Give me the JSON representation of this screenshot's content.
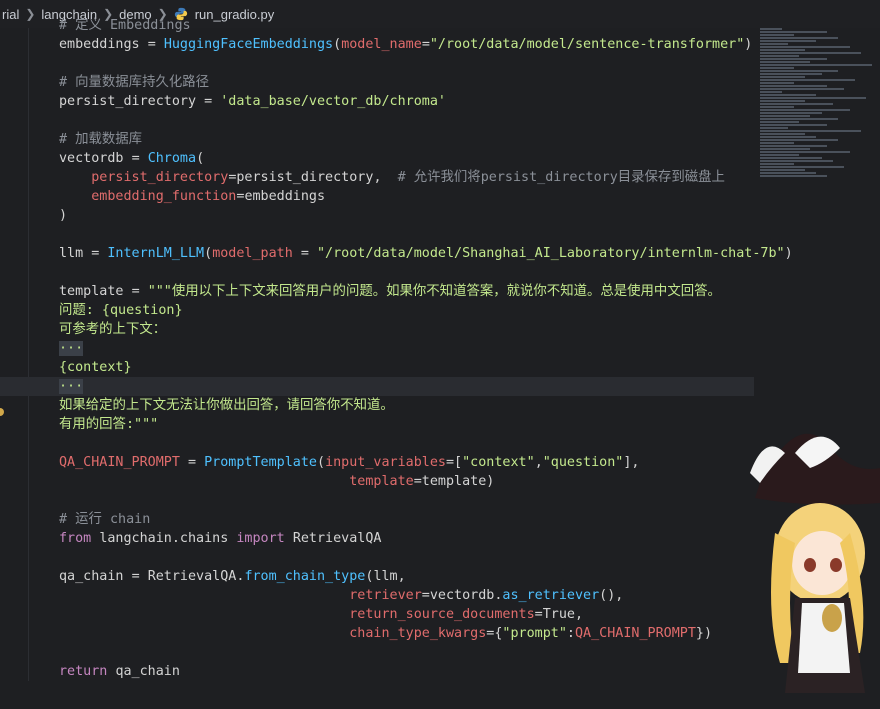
{
  "breadcrumb": {
    "items": [
      "rial",
      "langchain",
      "demo",
      "run_gradio.py"
    ]
  },
  "code_lines": [
    {
      "parts": [
        [
          "cmt",
          "# 定义 Embeddings"
        ]
      ]
    },
    {
      "parts": [
        [
          "var",
          "embeddings "
        ],
        [
          "op",
          "= "
        ],
        [
          "fn",
          "HuggingFaceEmbeddings"
        ],
        [
          "op",
          "("
        ],
        [
          "param",
          "model_name"
        ],
        [
          "op",
          "="
        ],
        [
          "strg",
          "\"/root/data/model/sentence-transformer\""
        ],
        [
          "op",
          ")"
        ]
      ]
    },
    {
      "parts": []
    },
    {
      "parts": [
        [
          "cmt",
          "# 向量数据库持久化路径"
        ]
      ]
    },
    {
      "parts": [
        [
          "var",
          "persist_directory "
        ],
        [
          "op",
          "= "
        ],
        [
          "strg",
          "'data_base/vector_db/chroma'"
        ]
      ]
    },
    {
      "parts": []
    },
    {
      "parts": [
        [
          "cmt",
          "# 加载数据库"
        ]
      ]
    },
    {
      "parts": [
        [
          "var",
          "vectordb "
        ],
        [
          "op",
          "= "
        ],
        [
          "fn",
          "Chroma"
        ],
        [
          "op",
          "("
        ]
      ]
    },
    {
      "parts": [
        [
          "param",
          "    persist_directory"
        ],
        [
          "op",
          "="
        ],
        [
          "var",
          "persist_directory"
        ],
        [
          "op",
          ",  "
        ],
        [
          "cmt",
          "# 允许我们将persist_directory目录保存到磁盘上"
        ]
      ]
    },
    {
      "parts": [
        [
          "param",
          "    embedding_function"
        ],
        [
          "op",
          "="
        ],
        [
          "var",
          "embeddings"
        ]
      ]
    },
    {
      "parts": [
        [
          "op",
          ")"
        ]
      ]
    },
    {
      "parts": []
    },
    {
      "parts": [
        [
          "var",
          "llm "
        ],
        [
          "op",
          "= "
        ],
        [
          "fn",
          "InternLM_LLM"
        ],
        [
          "op",
          "("
        ],
        [
          "param",
          "model_path "
        ],
        [
          "op",
          "= "
        ],
        [
          "strg",
          "\"/root/data/model/Shanghai_AI_Laboratory/internlm-chat-7b\""
        ],
        [
          "op",
          ")"
        ]
      ]
    },
    {
      "parts": []
    },
    {
      "parts": [
        [
          "var",
          "template "
        ],
        [
          "op",
          "= "
        ],
        [
          "strg",
          "\"\"\"使用以下上下文来回答用户的问题。如果你不知道答案，就说你不知道。总是使用中文回答。"
        ]
      ]
    },
    {
      "parts": [
        [
          "tmpl",
          "问题: {question}"
        ]
      ]
    },
    {
      "parts": [
        [
          "tmpl",
          "可参考的上下文："
        ]
      ]
    },
    {
      "parts": [
        [
          "sel",
          "···"
        ]
      ]
    },
    {
      "parts": [
        [
          "tmpl",
          "{context}"
        ]
      ]
    },
    {
      "parts": [
        [
          "sel",
          "···"
        ]
      ],
      "current": true
    },
    {
      "parts": [
        [
          "tmpl",
          "如果给定的上下文无法让你做出回答，请回答你不知道。"
        ]
      ]
    },
    {
      "parts": [
        [
          "tmpl",
          "有用的回答:\"\"\""
        ]
      ]
    },
    {
      "parts": []
    },
    {
      "parts": [
        [
          "param",
          "QA_CHAIN_PROMPT "
        ],
        [
          "op",
          "= "
        ],
        [
          "fn",
          "PromptTemplate"
        ],
        [
          "op",
          "("
        ],
        [
          "param",
          "input_variables"
        ],
        [
          "op",
          "=["
        ],
        [
          "strg",
          "\"context\""
        ],
        [
          "op",
          ","
        ],
        [
          "strg",
          "\"question\""
        ],
        [
          "op",
          "],"
        ]
      ]
    },
    {
      "parts": [
        [
          "op",
          "                                    "
        ],
        [
          "param",
          "template"
        ],
        [
          "op",
          "="
        ],
        [
          "var",
          "template"
        ],
        [
          "op",
          ")"
        ]
      ]
    },
    {
      "parts": []
    },
    {
      "parts": [
        [
          "cmt",
          "# 运行 chain"
        ]
      ]
    },
    {
      "parts": [
        [
          "kw",
          "from "
        ],
        [
          "var",
          "langchain.chains "
        ],
        [
          "kw",
          "import "
        ],
        [
          "var",
          "RetrievalQA"
        ]
      ]
    },
    {
      "parts": []
    },
    {
      "parts": [
        [
          "var",
          "qa_chain "
        ],
        [
          "op",
          "= "
        ],
        [
          "var",
          "RetrievalQA."
        ],
        [
          "fn",
          "from_chain_type"
        ],
        [
          "op",
          "("
        ],
        [
          "var",
          "llm"
        ],
        [
          "op",
          ","
        ]
      ]
    },
    {
      "parts": [
        [
          "op",
          "                                    "
        ],
        [
          "param",
          "retriever"
        ],
        [
          "op",
          "="
        ],
        [
          "var",
          "vectordb."
        ],
        [
          "fn",
          "as_retriever"
        ],
        [
          "op",
          "(),"
        ]
      ]
    },
    {
      "parts": [
        [
          "op",
          "                                    "
        ],
        [
          "param",
          "return_source_documents"
        ],
        [
          "op",
          "="
        ],
        [
          "var",
          "True"
        ],
        [
          "op",
          ","
        ]
      ]
    },
    {
      "parts": [
        [
          "op",
          "                                    "
        ],
        [
          "param",
          "chain_type_kwargs"
        ],
        [
          "op",
          "={"
        ],
        [
          "strg",
          "\"prompt\""
        ],
        [
          "op",
          ":"
        ],
        [
          "param",
          "QA_CHAIN_PROMPT"
        ],
        [
          "op",
          "})"
        ]
      ]
    },
    {
      "parts": []
    },
    {
      "parts": [
        [
          "kw",
          "return "
        ],
        [
          "var",
          "qa_chain"
        ]
      ]
    }
  ],
  "colors": {
    "background": "#1e1f22",
    "comment": "#8b9098",
    "function": "#4fc1ff",
    "string": "#c3e88d",
    "parameter": "#e06c6c",
    "keyword": "#c586c0"
  }
}
